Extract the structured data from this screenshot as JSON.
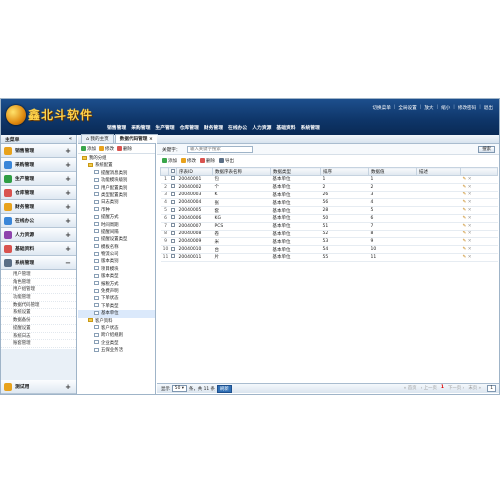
{
  "header": {
    "logo_text": "鑫北斗软件",
    "top_links": [
      "切换菜单",
      "全局设置",
      "放大",
      "缩小",
      "修改密码",
      "退出"
    ],
    "main_nav": [
      "销售管理",
      "采购管理",
      "生产管理",
      "仓库管理",
      "财务管理",
      "在线办公",
      "人力资源",
      "基础资料",
      "系统管理"
    ]
  },
  "sidebar": {
    "title": "主菜单",
    "collapse": "«",
    "modules": [
      {
        "label": "销售管理",
        "toggle": "+",
        "color": "#e8a21c"
      },
      {
        "label": "采购管理",
        "toggle": "+",
        "color": "#3a86d8"
      },
      {
        "label": "生产管理",
        "toggle": "+",
        "color": "#2f9e44"
      },
      {
        "label": "仓库管理",
        "toggle": "+",
        "color": "#d9534f"
      },
      {
        "label": "财务管理",
        "toggle": "+",
        "color": "#e8a21c"
      },
      {
        "label": "在线办公",
        "toggle": "+",
        "color": "#3a86d8"
      },
      {
        "label": "人力资源",
        "toggle": "+",
        "color": "#8e44ad"
      },
      {
        "label": "基础资料",
        "toggle": "+",
        "color": "#d9534f"
      },
      {
        "label": "系统管理",
        "toggle": "−",
        "color": "#5b6f86"
      }
    ],
    "system_items": [
      "用户管理",
      "角色管理",
      "用户组管理",
      "功能管理",
      "数据代码管理",
      "系统设置",
      "数据备份",
      "提醒设置",
      "系统日志",
      "账套管理"
    ],
    "bottom_module": {
      "label": "测试用",
      "toggle": "+"
    }
  },
  "tree": {
    "tabs": [
      "我的主页",
      "数据代码管理"
    ],
    "tab_close": "×",
    "tools": {
      "add": "添加",
      "edit": "修改",
      "delete": "删除"
    },
    "nodes": [
      {
        "label": "我的分组",
        "level": 0,
        "type": "folder"
      },
      {
        "label": "系统配置",
        "level": 1,
        "type": "folder"
      },
      {
        "label": "提醒消息类别",
        "level": 2,
        "type": "leaf"
      },
      {
        "label": "功能模块级别",
        "level": 2,
        "type": "leaf"
      },
      {
        "label": "用户配置类别",
        "level": 2,
        "type": "leaf"
      },
      {
        "label": "类型配置类别",
        "level": 2,
        "type": "leaf"
      },
      {
        "label": "日志类别",
        "level": 2,
        "type": "leaf"
      },
      {
        "label": "币种",
        "level": 2,
        "type": "leaf"
      },
      {
        "label": "提醒方式",
        "level": 2,
        "type": "leaf"
      },
      {
        "label": "时间周期",
        "level": 2,
        "type": "leaf"
      },
      {
        "label": "提醒间隔",
        "level": 2,
        "type": "leaf"
      },
      {
        "label": "提醒设置类型",
        "level": 2,
        "type": "leaf"
      },
      {
        "label": "模板名称",
        "level": 2,
        "type": "leaf"
      },
      {
        "label": "物流公司",
        "level": 2,
        "type": "leaf"
      },
      {
        "label": "版本类别",
        "level": 2,
        "type": "leaf"
      },
      {
        "label": "项目模块",
        "level": 2,
        "type": "leaf"
      },
      {
        "label": "版本类型",
        "level": 2,
        "type": "leaf"
      },
      {
        "label": "报税方式",
        "level": 2,
        "type": "leaf"
      },
      {
        "label": "免费声明",
        "level": 2,
        "type": "leaf"
      },
      {
        "label": "下单状态",
        "level": 2,
        "type": "leaf"
      },
      {
        "label": "下单类型",
        "level": 2,
        "type": "leaf"
      },
      {
        "label": "基本单位",
        "level": 2,
        "type": "leaf",
        "selected": true
      },
      {
        "label": "客户资料",
        "level": 1,
        "type": "folder"
      },
      {
        "label": "客户状态",
        "level": 2,
        "type": "leaf"
      },
      {
        "label": "跨介绍规则",
        "level": 2,
        "type": "leaf"
      },
      {
        "label": "企业类型",
        "level": 2,
        "type": "leaf"
      },
      {
        "label": "五保业务活",
        "level": 2,
        "type": "leaf"
      }
    ]
  },
  "content": {
    "search_label": "关键字：",
    "search_placeholder": "输入关键字搜索",
    "search_button": "搜索",
    "tools": {
      "add": "添加",
      "edit": "修改",
      "delete": "删除",
      "export": "导出"
    },
    "columns": [
      "",
      "",
      "序表ID",
      "数据序表名称",
      "数据类型",
      "排序",
      "数据值",
      "描述",
      ""
    ],
    "rows": [
      {
        "no": "1",
        "id": "20040001",
        "name": "包",
        "type": "基本单位",
        "sort": "1",
        "value": "1"
      },
      {
        "no": "2",
        "id": "20040002",
        "name": "个",
        "type": "基本单位",
        "sort": "2",
        "value": "2"
      },
      {
        "no": "3",
        "id": "20040003",
        "name": "K",
        "type": "基本单位",
        "sort": "26",
        "value": "3"
      },
      {
        "no": "4",
        "id": "20040004",
        "name": "张",
        "type": "基本单位",
        "sort": "56",
        "value": "4"
      },
      {
        "no": "5",
        "id": "20040005",
        "name": "套",
        "type": "基本单位",
        "sort": "28",
        "value": "5"
      },
      {
        "no": "6",
        "id": "20040006",
        "name": "KG",
        "type": "基本单位",
        "sort": "50",
        "value": "6"
      },
      {
        "no": "7",
        "id": "20040007",
        "name": "PCS",
        "type": "基本单位",
        "sort": "51",
        "value": "7"
      },
      {
        "no": "8",
        "id": "20040008",
        "name": "卷",
        "type": "基本单位",
        "sort": "52",
        "value": "8"
      },
      {
        "no": "9",
        "id": "20040009",
        "name": "米",
        "type": "基本单位",
        "sort": "53",
        "value": "9"
      },
      {
        "no": "10",
        "id": "20040010",
        "name": "台",
        "type": "基本单位",
        "sort": "54",
        "value": "10"
      },
      {
        "no": "11",
        "id": "20040011",
        "name": "片",
        "type": "基本单位",
        "sort": "55",
        "value": "11"
      }
    ],
    "pager": {
      "show_label": "显示",
      "page_size": "50",
      "summary": "条，共 11 条",
      "go": "刷新",
      "first": "首页",
      "prev": "上一页",
      "current": "1",
      "next": "下一页",
      "last": "末页",
      "page_input": "1"
    }
  }
}
